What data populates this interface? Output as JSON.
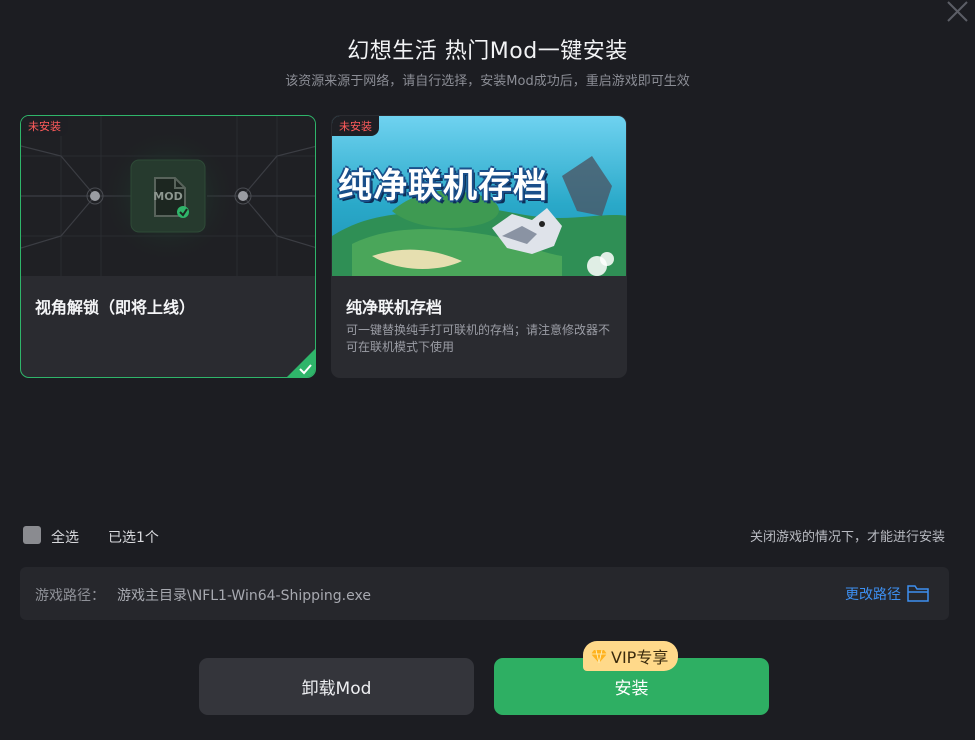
{
  "dialog": {
    "title": "幻想生活 热门Mod一键安装",
    "subtitle": "该资源来源于网络，请自行选择，安装Mod成功后，重启游戏即可生效"
  },
  "mods": [
    {
      "status": "未安装",
      "title": "视角解锁（即将上线）",
      "description": "",
      "selected": true,
      "icon": "mod-file-icon",
      "thumb_label": "MOD"
    },
    {
      "status": "未安装",
      "title": "纯净联机存档",
      "description": "可一键替换纯手打可联机的存档；请注意修改器不可在联机模式下使用",
      "selected": false,
      "banner_text": "纯净联机存档"
    }
  ],
  "footer": {
    "select_all_label": "全选",
    "selected_count": "已选1个",
    "hint": "关闭游戏的情况下，才能进行安装"
  },
  "path": {
    "label": "游戏路径：",
    "value": "游戏主目录\\NFL1-Win64-Shipping.exe",
    "change_label": "更改路径"
  },
  "buttons": {
    "uninstall": "卸载Mod",
    "install": "安装",
    "vip_badge": "VIP专享"
  },
  "colors": {
    "background": "#1c1d22",
    "accent_green": "#2eaf63",
    "link_blue": "#3d8ff0",
    "badge_red": "#ff5b5b",
    "vip_gold": "#ffd98a"
  }
}
